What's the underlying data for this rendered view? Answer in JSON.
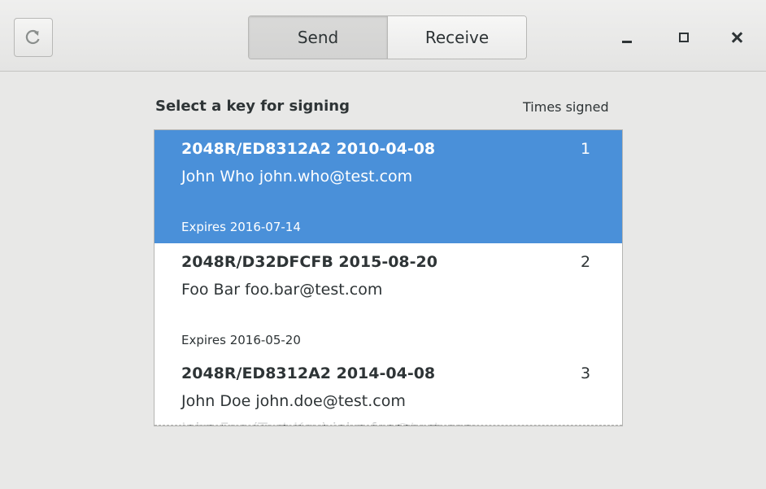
{
  "header": {
    "refresh_icon": "refresh-icon",
    "tabs": [
      {
        "label": "Send",
        "active": true
      },
      {
        "label": "Receive",
        "active": false
      }
    ],
    "window_controls": [
      "minimize-icon",
      "maximize-icon",
      "close-icon"
    ]
  },
  "key_list": {
    "title": "Select a key for signing",
    "column_header": "Times signed",
    "keys": [
      {
        "id": "2048R/ED8312A2 2010-04-08",
        "uids": [
          "John Who john.who@test.com"
        ],
        "expires": "Expires 2016-07-14",
        "times_signed": "1",
        "selected": true
      },
      {
        "id": "2048R/D32DFCFB 2015-08-20",
        "uids": [
          "Foo Bar foo.bar@test.com"
        ],
        "expires": "Expires 2016-05-20",
        "times_signed": "2",
        "selected": false
      },
      {
        "id": "2048R/ED8312A2 2014-04-08",
        "uids": [
          "John Doe john.doe@test.com",
          "John Foo (Test Key) john.foo@test.com"
        ],
        "expires": "",
        "times_signed": "3",
        "selected": false
      }
    ]
  },
  "colors": {
    "selection": "#4a90d9",
    "window_bg": "#e8e8e7",
    "text": "#2e3436"
  }
}
